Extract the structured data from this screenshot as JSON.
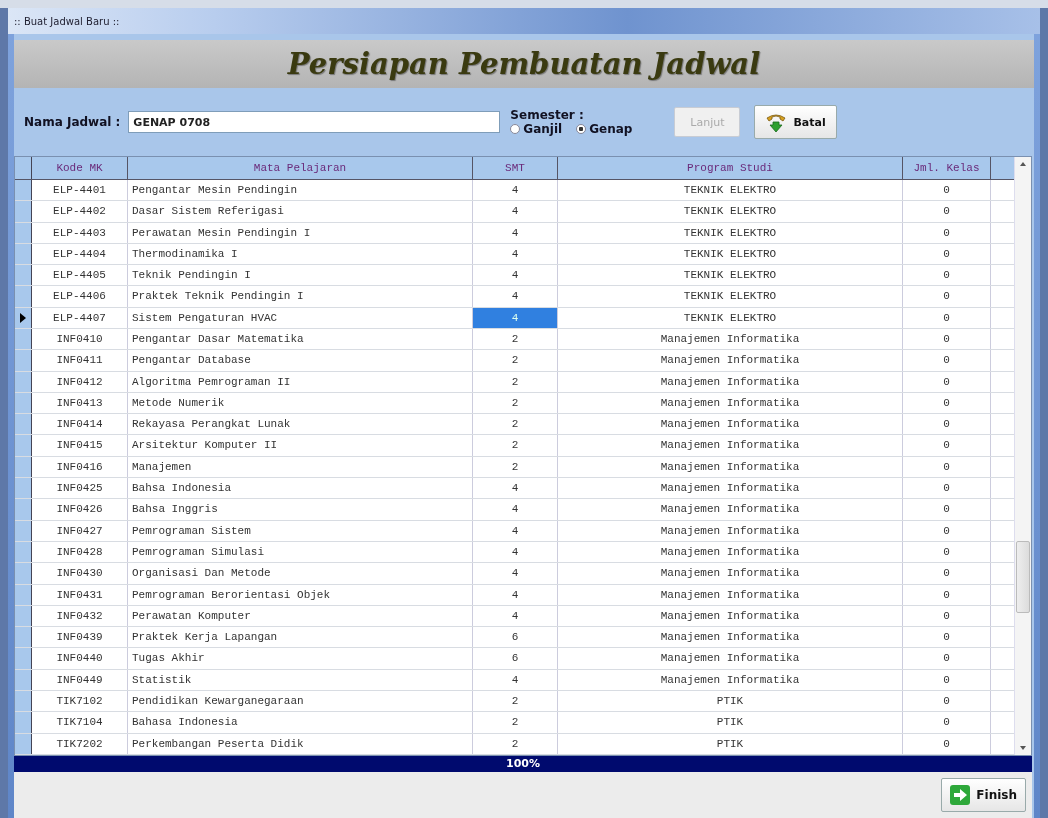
{
  "window": {
    "title": ":: Buat Jadwal Baru ::"
  },
  "heading": "Persiapan Pembuatan Jadwal",
  "form": {
    "name_label": "Nama Jadwal :",
    "name_value": "GENAP 0708",
    "semester_label": "Semester :",
    "semester_options": [
      {
        "label": "Ganjil",
        "selected": false
      },
      {
        "label": "Genap",
        "selected": true
      }
    ],
    "buttons": [
      {
        "kind": "next",
        "label": "Lanjut",
        "disabled": true
      },
      {
        "kind": "cancel",
        "label": "Batal",
        "disabled": false
      }
    ]
  },
  "table": {
    "columns": [
      "Kode MK",
      "Mata Pelajaran",
      "SMT",
      "Program Studi",
      "Jml. Kelas"
    ],
    "rows": [
      {
        "cells": [
          "ELP-4401",
          "Pengantar Mesin Pendingin",
          "4",
          "TEKNIK ELEKTRO",
          "0"
        ],
        "selected": false
      },
      {
        "cells": [
          "ELP-4402",
          "Dasar Sistem Referigasi",
          "4",
          "TEKNIK ELEKTRO",
          "0"
        ],
        "selected": false
      },
      {
        "cells": [
          "ELP-4403",
          "Perawatan Mesin Pendingin I",
          "4",
          "TEKNIK ELEKTRO",
          "0"
        ],
        "selected": false
      },
      {
        "cells": [
          "ELP-4404",
          "Thermodinamika I",
          "4",
          "TEKNIK ELEKTRO",
          "0"
        ],
        "selected": false
      },
      {
        "cells": [
          "ELP-4405",
          "Teknik Pendingin I",
          "4",
          "TEKNIK ELEKTRO",
          "0"
        ],
        "selected": false
      },
      {
        "cells": [
          "ELP-4406",
          "Praktek Teknik Pendingin I",
          "4",
          "TEKNIK ELEKTRO",
          "0"
        ],
        "selected": false
      },
      {
        "cells": [
          "ELP-4407",
          "Sistem Pengaturan HVAC",
          "4",
          "TEKNIK ELEKTRO",
          "0"
        ],
        "selected": true
      },
      {
        "cells": [
          "INF0410",
          "Pengantar Dasar Matematika",
          "2",
          "Manajemen Informatika",
          "0"
        ],
        "selected": false
      },
      {
        "cells": [
          "INF0411",
          "Pengantar Database",
          "2",
          "Manajemen Informatika",
          "0"
        ],
        "selected": false
      },
      {
        "cells": [
          "INF0412",
          "Algoritma Pemrograman II",
          "2",
          "Manajemen Informatika",
          "0"
        ],
        "selected": false
      },
      {
        "cells": [
          "INF0413",
          "Metode Numerik",
          "2",
          "Manajemen Informatika",
          "0"
        ],
        "selected": false
      },
      {
        "cells": [
          "INF0414",
          "Rekayasa Perangkat Lunak",
          "2",
          "Manajemen Informatika",
          "0"
        ],
        "selected": false
      },
      {
        "cells": [
          "INF0415",
          "Arsitektur Komputer II",
          "2",
          "Manajemen Informatika",
          "0"
        ],
        "selected": false
      },
      {
        "cells": [
          "INF0416",
          "Manajemen",
          "2",
          "Manajemen Informatika",
          "0"
        ],
        "selected": false
      },
      {
        "cells": [
          "INF0425",
          "Bahsa Indonesia",
          "4",
          "Manajemen Informatika",
          "0"
        ],
        "selected": false
      },
      {
        "cells": [
          "INF0426",
          "Bahsa Inggris",
          "4",
          "Manajemen Informatika",
          "0"
        ],
        "selected": false
      },
      {
        "cells": [
          "INF0427",
          "Pemrograman Sistem",
          "4",
          "Manajemen Informatika",
          "0"
        ],
        "selected": false
      },
      {
        "cells": [
          "INF0428",
          "Pemrograman Simulasi",
          "4",
          "Manajemen Informatika",
          "0"
        ],
        "selected": false
      },
      {
        "cells": [
          "INF0430",
          "Organisasi Dan Metode",
          "4",
          "Manajemen Informatika",
          "0"
        ],
        "selected": false
      },
      {
        "cells": [
          "INF0431",
          "Pemrograman Berorientasi Objek",
          "4",
          "Manajemen Informatika",
          "0"
        ],
        "selected": false
      },
      {
        "cells": [
          "INF0432",
          "Perawatan Komputer",
          "4",
          "Manajemen Informatika",
          "0"
        ],
        "selected": false
      },
      {
        "cells": [
          "INF0439",
          "Praktek Kerja Lapangan",
          "6",
          "Manajemen Informatika",
          "0"
        ],
        "selected": false
      },
      {
        "cells": [
          "INF0440",
          "Tugas Akhir",
          "6",
          "Manajemen Informatika",
          "0"
        ],
        "selected": false
      },
      {
        "cells": [
          "INF0449",
          "Statistik",
          "4",
          "Manajemen Informatika",
          "0"
        ],
        "selected": false
      },
      {
        "cells": [
          "TIK7102",
          "Pendidikan Kewarganegaraan",
          "2",
          "PTIK",
          "0"
        ],
        "selected": false
      },
      {
        "cells": [
          "TIK7104",
          "Bahasa Indonesia",
          "2",
          "PTIK",
          "0"
        ],
        "selected": false
      },
      {
        "cells": [
          "TIK7202",
          "Perkembangan Peserta Didik",
          "2",
          "PTIK",
          "0"
        ],
        "selected": false
      }
    ]
  },
  "progress": {
    "level": 1,
    "reading": "100%"
  },
  "finish_button": "Finish"
}
